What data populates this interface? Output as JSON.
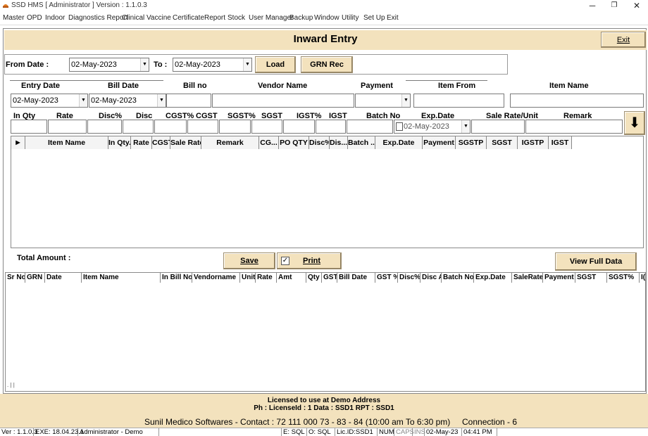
{
  "window": {
    "title": "SSD HMS [ Administrator ] Version : 1.1.0.3",
    "minimize_glyph": "─",
    "maximize_glyph": "❐",
    "close_glyph": "✕"
  },
  "menu": [
    "Master",
    "OPD",
    "Indoor",
    "Diagnostics Report",
    "Clinical",
    "Vaccine",
    "Certificate",
    "Report",
    "Stock",
    "User Manager",
    "Backup",
    "Window",
    "Utility",
    "Set Up",
    "Exit"
  ],
  "page": {
    "title": "Inward Entry",
    "exit_label": "Exit"
  },
  "filter": {
    "from_label": "From Date :",
    "from_value": "02-May-2023",
    "to_label": "To :",
    "to_value": "02-May-2023",
    "load_label": "Load",
    "grn_label": "GRN Rec"
  },
  "entry": {
    "labels": {
      "entry_date": "Entry Date",
      "bill_date": "Bill Date",
      "bill_no": "Bill no",
      "vendor_name": "Vendor Name",
      "payment": "Payment",
      "item_from": "Item From",
      "item_name": "Item Name"
    },
    "entry_date_value": "02-May-2023",
    "bill_date_value": "02-May-2023"
  },
  "item_row": {
    "labels": [
      "In Qty",
      "Rate",
      "Disc%",
      "Disc",
      "CGST%",
      "CGST",
      "SGST%",
      "SGST",
      "IGST%",
      "IGST",
      "Batch No",
      "Exp.Date",
      "Sale Rate/Unit",
      "Remark"
    ],
    "exp_date_value": "02-May-2023",
    "down_arrow_glyph": "⬇"
  },
  "items_grid": {
    "row_indicator": "▶",
    "columns": [
      "Item Name",
      "In Qty.",
      "Rate",
      "CGST",
      "Sale Rate",
      "Remark",
      "CG...",
      "PO QTY",
      "Disc%",
      "Dis...",
      "Batch ...",
      "Exp.Date",
      "Payment",
      "SGSTP",
      "SGST",
      "IGSTP",
      "IGST"
    ]
  },
  "totals": {
    "total_label": "Total Amount :",
    "save_label": "Save",
    "print_label": "Print",
    "print_checked_glyph": "✓",
    "view_full_label": "View Full Data"
  },
  "history_grid": {
    "columns": [
      "Sr No",
      "GRN N",
      "Date",
      "Item Name",
      "In Bill No",
      "Vendorname",
      "Unit",
      "Rate",
      "Amt",
      "Qty",
      "GST",
      "Bill Date",
      "GST %",
      "Disc%",
      "Disc A",
      "Batch No",
      "Exp.Date",
      "SaleRate",
      "Payment",
      "SGST",
      "SGST%",
      "I("
    ],
    "scroll_marker": ". | |"
  },
  "footer": {
    "license_line1": "Licensed to use at Demo Address",
    "license_line2": "Ph :   LicenseId : 1  Data : SSD1 RPT : SSD1",
    "contact": "Sunil Medico Softwares - Contact : 72 111 000 73 - 83 - 84  (10:00 am To 6:30 pm)",
    "connection": "Connection - 6"
  },
  "status": [
    "Ver : 1.1.0.3",
    "EXE: 18.04.23.1",
    "Administrator - Demo",
    "",
    "E: SQL",
    "O: SQL",
    "Lic.ID:SSD1",
    "NUM",
    "CAPS",
    "INS",
    "02-May-23",
    "04:41 PM"
  ]
}
